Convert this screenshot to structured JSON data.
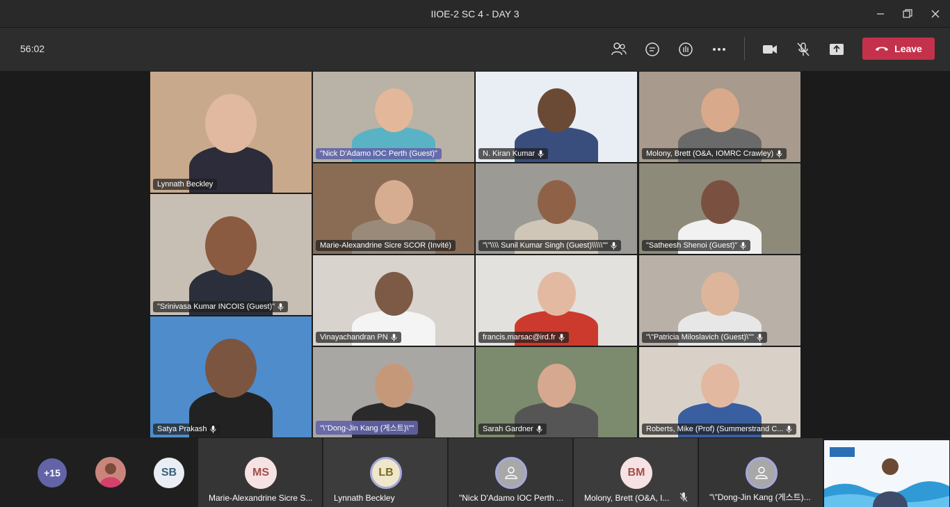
{
  "window": {
    "title": "IIOE-2 SC 4 - DAY 3"
  },
  "toolbar": {
    "timer": "56:02",
    "leave_label": "Leave",
    "leave_color": "#c4314b"
  },
  "tiles": [
    {
      "name": "Lynnath Beckley",
      "bg": "#c9a98c",
      "mic": false,
      "hl": false
    },
    {
      "name": "\"Nick D'Adamo IOC Perth (Guest)\"",
      "bg": "#b9b2a6",
      "mic": false,
      "hl": true
    },
    {
      "name": "N. Kiran Kumar",
      "bg": "#e9eef5",
      "mic": true,
      "hl": false
    },
    {
      "name": "Molony, Brett (O&A, IOMRC Crawley)",
      "bg": "#a89a8c",
      "mic": true,
      "hl": false
    },
    {
      "name": "\"Srinivasa Kumar INCOIS (Guest)\"",
      "bg": "#c8bfb4",
      "mic": true,
      "hl": false
    },
    {
      "name": "Marie-Alexandrine Sicre SCOR (Invité)",
      "bg": "#8a6c55",
      "mic": false,
      "hl": false
    },
    {
      "name": "\"\\\"\\\\\\\\ Sunil Kumar Singh (Guest)\\\\\\\\\\\"\"",
      "bg": "#9c9a94",
      "mic": true,
      "hl": false
    },
    {
      "name": "\"Satheesh Shenoi (Guest)\"",
      "bg": "#8e8a79",
      "mic": true,
      "hl": false
    },
    {
      "name": "Vinayachandran PN",
      "bg": "#d8d3cd",
      "mic": true,
      "hl": false
    },
    {
      "name": "francis.marsac@ird.fr",
      "bg": "#e3e1de",
      "mic": true,
      "hl": false
    },
    {
      "name": "\"\\\"Patricia Miloslavich (Guest)\\\"\"",
      "bg": "#b9b0a8",
      "mic": true,
      "hl": false
    },
    {
      "name": "Satya Prakash",
      "bg": "#4e8ccc",
      "mic": true,
      "hl": false
    },
    {
      "name": "\"\\\"Dong-Jin Kang (게스트)\\\"\"",
      "bg": "#a9a7a4",
      "mic": false,
      "hl": true
    },
    {
      "name": "Sarah Gardner",
      "bg": "#7c8a6e",
      "mic": true,
      "hl": false
    },
    {
      "name": "Roberts, Mike (Prof) (Summerstrand C...",
      "bg": "#d9d1c7",
      "mic": true,
      "hl": false
    }
  ],
  "overflow": {
    "count": "+15"
  },
  "bottom_avatars": [
    {
      "initials": "SB"
    }
  ],
  "strip": [
    {
      "initials": "MS",
      "label": "Marie-Alexandrine Sicre S...",
      "ring": false,
      "mic": false
    },
    {
      "initials": "LB",
      "label": "Lynnath Beckley",
      "ring": true,
      "mic": false
    },
    {
      "initials": "",
      "label": "\"Nick D'Adamo IOC Perth ...",
      "ring": true,
      "mic": false
    },
    {
      "initials": "BM",
      "label": "Molony, Brett (O&A, I...",
      "ring": false,
      "mic": true
    },
    {
      "initials": "",
      "label": "\"\\\"Dong-Jin Kang (게스트)...",
      "ring": true,
      "mic": false
    }
  ]
}
